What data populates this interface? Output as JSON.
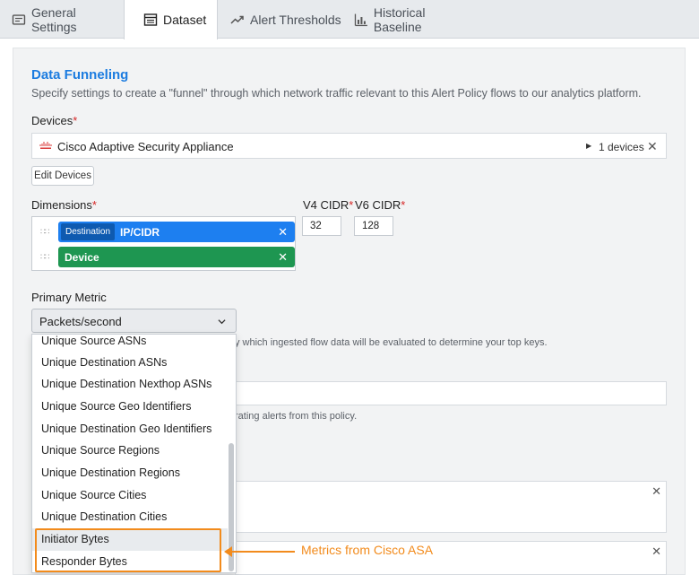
{
  "tabs": [
    {
      "label": "General Settings",
      "icon": "settings-card-icon",
      "active": false
    },
    {
      "label": "Dataset",
      "icon": "table-icon",
      "active": true
    },
    {
      "label": "Alert Thresholds",
      "icon": "trend-up-icon",
      "active": false
    },
    {
      "label": "Historical Baseline",
      "icon": "bar-chart-icon",
      "active": false
    }
  ],
  "section": {
    "title": "Data Funneling",
    "description": "Specify settings to create a \"funnel\" through which network traffic relevant to this Alert Policy flows to our analytics platform."
  },
  "devices": {
    "label": "Devices",
    "required_mark": "*",
    "selected_name": "Cisco Adaptive Security Appliance",
    "count_text": "1 devices",
    "edit_button": "Edit Devices"
  },
  "dimensions": {
    "label": "Dimensions",
    "required_mark": "*",
    "chips": [
      {
        "tag": "Destination",
        "label": "IP/CIDR",
        "color": "#1d7ff0"
      },
      {
        "tag": "",
        "label": "Device",
        "color": "#1e9651"
      }
    ],
    "close_glyph": "✕"
  },
  "cidr": {
    "v4_label": "V4 CIDR",
    "v4_value": "32",
    "v6_label": "V6 CIDR",
    "v6_value": "128",
    "required_mark": "*"
  },
  "primary_metric": {
    "label": "Primary Metric",
    "selected": "Packets/second",
    "helper_fragment": "y which ingested flow data will be evaluated to determine your top keys.",
    "options": [
      "Unique Source ASNs",
      "Unique Destination ASNs",
      "Unique Destination Nexthop ASNs",
      "Unique Source Geo Identifiers",
      "Unique Destination Geo Identifiers",
      "Unique Source Regions",
      "Unique Destination Regions",
      "Unique Source Cities",
      "Unique Destination Cities",
      "Initiator Bytes",
      "Responder Bytes"
    ],
    "highlighted_option": "Initiator Bytes"
  },
  "background": {
    "helper_fragment_2": "rating alerts from this policy.",
    "close_glyph": "✕"
  },
  "annotation": {
    "text": "Metrics from Cisco ASA",
    "color": "#f28b1c"
  }
}
